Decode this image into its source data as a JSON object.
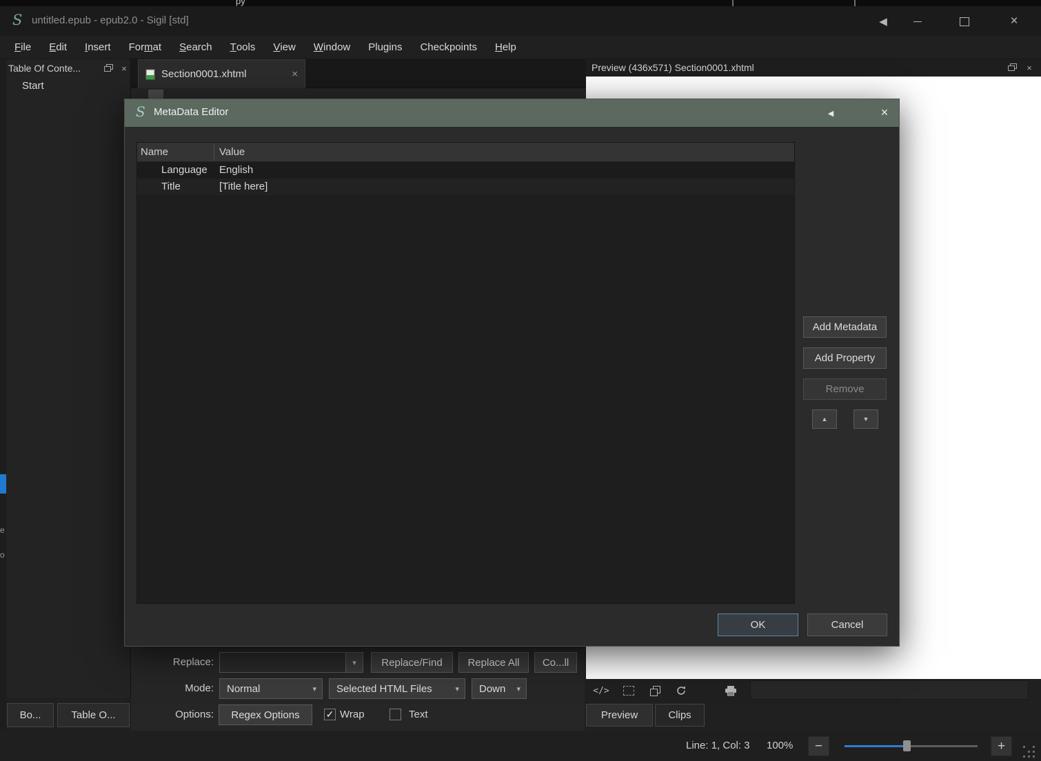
{
  "colors": {
    "accent_blue": "#2d7dd2",
    "dialog_titlebar_green": "#5b695f",
    "left_strip_highlight": "#1f7ad1",
    "preview_background": "#ffffff"
  },
  "background_fragments": {
    "top_text": "py",
    "left_edge": [
      "e",
      "o"
    ]
  },
  "titlebar": {
    "app_title": "untitled.epub - epub2.0 - Sigil [std]"
  },
  "menubar": {
    "items": [
      {
        "label": "File"
      },
      {
        "label": "Edit"
      },
      {
        "label": "Insert"
      },
      {
        "label": "Format"
      },
      {
        "label": "Search"
      },
      {
        "label": "Tools"
      },
      {
        "label": "View"
      },
      {
        "label": "Window"
      },
      {
        "label": "Plugins"
      },
      {
        "label": "Checkpoints"
      },
      {
        "label": "Help"
      }
    ]
  },
  "toc_panel": {
    "title": "Table Of Conte...",
    "start_item": "Start"
  },
  "editor": {
    "tab_label": "Section0001.xhtml"
  },
  "preview": {
    "header": "Preview (436x571) Section0001.xhtml",
    "tabs": {
      "preview": "Preview",
      "clips": "Clips"
    }
  },
  "metadata_dialog": {
    "title": "MetaData Editor",
    "table": {
      "columns": {
        "name": "Name",
        "value": "Value"
      },
      "rows": [
        {
          "name": "Language",
          "value": "English"
        },
        {
          "name": "Title",
          "value": "[Title here]"
        }
      ]
    },
    "buttons": {
      "add_metadata": "Add Metadata",
      "add_property": "Add Property",
      "remove": "Remove",
      "ok": "OK",
      "cancel": "Cancel"
    }
  },
  "find_replace": {
    "replace_label": "Replace:",
    "replace_value": "",
    "buttons": {
      "replace_find": "Replace/Find",
      "replace_all": "Replace All",
      "count_all": "Co...ll"
    },
    "mode_label": "Mode:",
    "mode_value": "Normal",
    "files_value": "Selected HTML Files",
    "direction_value": "Down",
    "options_label": "Options:",
    "regex_options": "Regex Options",
    "wrap_label": "Wrap",
    "text_label": "Text",
    "wrap_checked": true,
    "text_checked": false
  },
  "bottom_left_tabs": [
    {
      "label": "Bo..."
    },
    {
      "label": "Table O..."
    }
  ],
  "statusbar": {
    "line_col": "Line: 1, Col: 3",
    "zoom": "100%"
  }
}
